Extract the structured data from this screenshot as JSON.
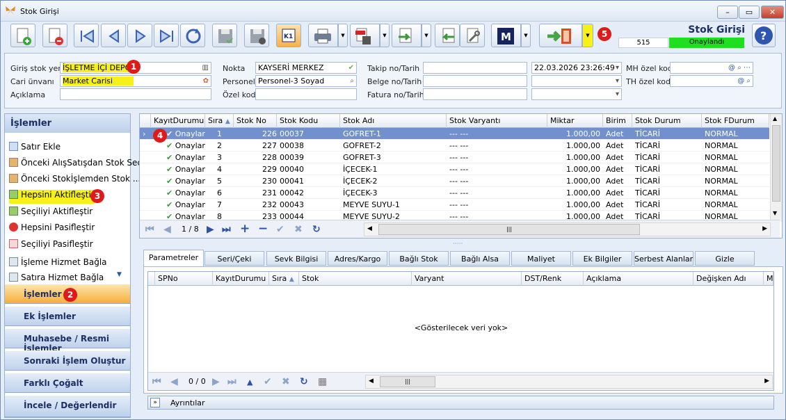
{
  "window": {
    "title": "Stok Girişi"
  },
  "header": {
    "heading": "Stok Girişi",
    "number": "515",
    "status": "Onaylandı",
    "status_color": "#1ee01e"
  },
  "toolbar": {
    "icons": [
      "new-document-icon",
      "delete-document-icon",
      "first-record-icon",
      "previous-record-icon",
      "next-record-icon",
      "last-record-icon",
      "refresh-icon",
      "save-icon",
      "save-close-icon",
      "k1-user-icon",
      "print-icon",
      "pdf-save-icon",
      "export-icon",
      "import-icon",
      "tools-icon",
      "m-app-icon",
      "exit-door-icon",
      "help-icon"
    ]
  },
  "form": {
    "giris_stok_yeri": {
      "label": "Giriş stok yeri",
      "value": "İŞLETME İÇİ DEPO"
    },
    "cari_unvani": {
      "label": "Cari ünvanı",
      "value": "Market Carisi"
    },
    "aciklama": {
      "label": "Açıklama",
      "value": ""
    },
    "nokta": {
      "label": "Nokta",
      "value": "KAYSERİ MERKEZ"
    },
    "personel": {
      "label": "Personel",
      "value": "Personel-3 Soyad"
    },
    "ozel_kod": {
      "label": "Özel kod",
      "value": ""
    },
    "takip": {
      "label": "Takip no/Tarih",
      "value": "",
      "date": "22.03.2026 23:26:49"
    },
    "belge": {
      "label": "Belge no/Tarih",
      "value": "",
      "date": ""
    },
    "fatura": {
      "label": "Fatura no/Tarih",
      "value": "",
      "date": ""
    },
    "mh_ozel_kod": {
      "label": "MH özel kod",
      "value": ""
    },
    "th_ozel_kod": {
      "label": "TH özel kod",
      "value": ""
    }
  },
  "badges": {
    "b1": "1",
    "b2": "2",
    "b3": "3",
    "b4": "4",
    "b5": "5"
  },
  "sidebar": {
    "header": "İşlemler",
    "items": [
      {
        "label": "Satır Ekle",
        "icon": "add-row-icon"
      },
      {
        "label": "Önceki AlışSatışdan Stok Seç",
        "icon": "folder-select-icon"
      },
      {
        "label": "Önceki Stokİşlemden Stok ...",
        "icon": "folder-select-icon"
      },
      {
        "label": "Hepsini Aktifleştir",
        "icon": "activate-all-icon"
      },
      {
        "label": "Seçiliyi Aktifleştir",
        "icon": "activate-selected-icon"
      },
      {
        "label": "Hepsini Pasifleştir",
        "icon": "deactivate-all-icon"
      },
      {
        "label": "Seçiliyi Pasifleştir",
        "icon": "deactivate-selected-icon"
      },
      {
        "label": "İşleme Hizmet Bağla",
        "icon": "link-service-icon"
      },
      {
        "label": "Satıra Hizmet Bağla",
        "icon": "link-service-icon"
      }
    ],
    "groups": [
      "İşlemler",
      "Ek İşlemler",
      "Muhasebe / Resmi İşlemler",
      "Sonraki İşlem Oluştur",
      "Farklı Çoğalt",
      "İncele / Değerlendir"
    ]
  },
  "grid": {
    "columns": [
      "KayıtDurumu",
      "Sıra",
      "Stok No",
      "Stok Kodu",
      "Stok Adı",
      "Stok Varyantı",
      "Miktar",
      "Birim",
      "Stok Durum",
      "Stok FDurum"
    ],
    "rows": [
      [
        "Onaylan",
        "1",
        "226",
        "00037",
        "GOFRET-1",
        "--- ---",
        "1.000,00",
        "Adet",
        "TİCARİ",
        "NORMAL"
      ],
      [
        "Onaylan",
        "2",
        "227",
        "00038",
        "GOFRET-2",
        "--- ---",
        "1.000,00",
        "Adet",
        "TİCARİ",
        "NORMAL"
      ],
      [
        "Onaylan",
        "3",
        "228",
        "00039",
        "GOFRET-3",
        "--- ---",
        "1.000,00",
        "Adet",
        "TİCARİ",
        "NORMAL"
      ],
      [
        "Onaylan",
        "4",
        "229",
        "00040",
        "İÇECEK-1",
        "--- ---",
        "1.000,00",
        "Adet",
        "TİCARİ",
        "NORMAL"
      ],
      [
        "Onaylan",
        "5",
        "230",
        "00041",
        "İÇECEK-2",
        "--- ---",
        "1.000,00",
        "Adet",
        "TİCARİ",
        "NORMAL"
      ],
      [
        "Onaylan",
        "6",
        "231",
        "00042",
        "İÇECEK-3",
        "--- ---",
        "1.000,00",
        "Adet",
        "TİCARİ",
        "NORMAL"
      ],
      [
        "Onaylan",
        "7",
        "232",
        "00043",
        "MEYVE SUYU-1",
        "--- ---",
        "1.000,00",
        "Adet",
        "TİCARİ",
        "NORMAL"
      ],
      [
        "Onaylan",
        "8",
        "233",
        "00044",
        "MEYVE SUYU-2",
        "--- ---",
        "1.000,00",
        "Adet",
        "TİCARİ",
        "NORMAL"
      ]
    ],
    "pager": "1 / 8"
  },
  "tabs": [
    "Parametreler",
    "Seri/Çeki",
    "Sevk Bilgisi",
    "Adres/Kargo",
    "Bağlı Stok",
    "Bağlı Alsa",
    "Maliyet",
    "Ek Bilgiler",
    "Serbest Alanlar",
    "Gizle"
  ],
  "subgrid": {
    "columns": [
      "SPNo",
      "KayıtDurumu",
      "Sıra",
      "Stok",
      "Varyant",
      "DST/Renk",
      "Açıklama",
      "Değişken Adı",
      "Mi"
    ],
    "empty_text": "<Gösterilecek veri yok>",
    "pager": "0 / 0"
  },
  "details": {
    "label": "Ayrıntılar"
  }
}
